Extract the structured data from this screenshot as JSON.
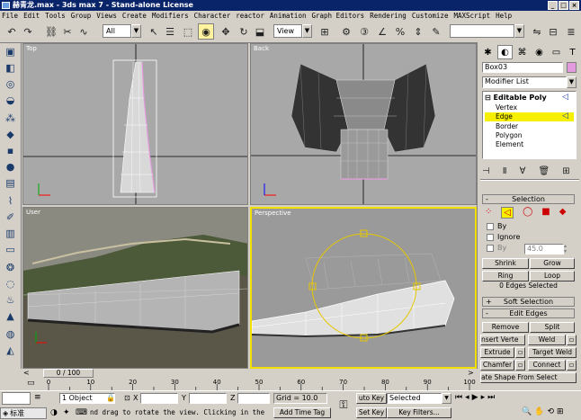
{
  "window": {
    "title": "赫青龙.max - 3ds max 7 - Stand-alone License"
  },
  "menu": [
    "File",
    "Edit",
    "Tools",
    "Group",
    "Views",
    "Create",
    "Modifiers",
    "Character",
    "reactor",
    "Animation",
    "Graph Editors",
    "Rendering",
    "Customize",
    "MAXScript",
    "Help"
  ],
  "toolbar": {
    "selection_filter": "All",
    "ref_coord": "View"
  },
  "viewports": {
    "top": "Top",
    "back": "Back",
    "user": "User",
    "perspective": "Perspective"
  },
  "command_panel": {
    "object_name": "Box03",
    "object_color": "#e49adf",
    "modifier_list": "Modifier List",
    "stack": [
      {
        "label": "Editable Poly",
        "kind": "base"
      },
      {
        "label": "Vertex",
        "kind": "sub"
      },
      {
        "label": "Edge",
        "kind": "sub",
        "selected": true
      },
      {
        "label": "Border",
        "kind": "sub"
      },
      {
        "label": "Polygon",
        "kind": "sub"
      },
      {
        "label": "Element",
        "kind": "sub"
      }
    ],
    "selection": {
      "header": "Selection",
      "by": "By",
      "ignore": "Ignore",
      "by_angle": "By",
      "angle_value": "45.0",
      "shrink": "Shrink",
      "grow": "Grow",
      "ring": "Ring",
      "loop": "Loop",
      "status": "0 Edges Selected"
    },
    "soft_selection": {
      "header": "Soft Selection"
    },
    "edit_edges": {
      "header": "Edit Edges",
      "remove": "Remove",
      "split": "Split",
      "insert_vertex": "nsert Verte",
      "weld": "Weld",
      "extrude": "Extrude",
      "target_weld": "Target Weld",
      "chamfer": "Chamfer",
      "connect": "Connect",
      "create_shape": "ate Shape From Select"
    }
  },
  "timeline": {
    "frame_label": "0 / 100",
    "ticks": [
      "0",
      "10",
      "20",
      "30",
      "40",
      "50",
      "60",
      "70",
      "80",
      "90",
      "100"
    ]
  },
  "status": {
    "objects": "1 Object",
    "x_label": "X",
    "y_label": "Y",
    "z_label": "Z",
    "grid": "Grid = 10.0",
    "auto_key": "uto Key",
    "set_key": "Set Key",
    "key_mode": "Selected",
    "key_filters": "Key Filters...",
    "prompt": "nd drag to rotate the view.  Clicking in the",
    "add_time_tag": "Add Time Tag",
    "ime": "标准"
  }
}
